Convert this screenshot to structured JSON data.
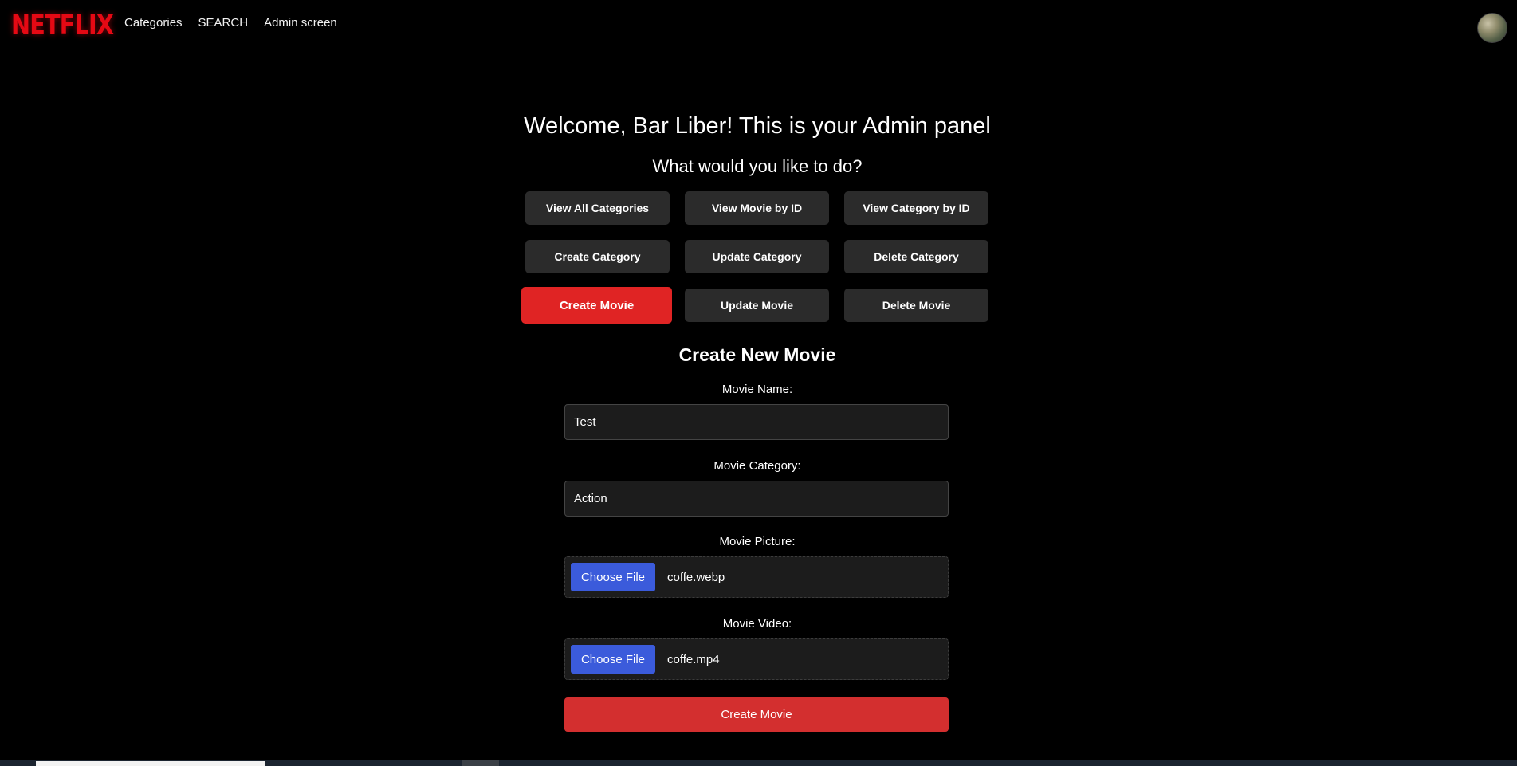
{
  "navbar": {
    "logo_text": "NETFLIX",
    "links": [
      "Categories",
      "SEARCH",
      "Admin screen"
    ],
    "avatar_icon": "user-avatar-icon"
  },
  "panel": {
    "welcome": "Welcome, Bar Liber! This is your Admin panel",
    "subtitle": "What would you like to do?",
    "actions": [
      "View All Categories",
      "View Movie by ID",
      "View Category by ID",
      "Create Category",
      "Update Category",
      "Delete Category",
      "Create Movie",
      "Update Movie",
      "Delete Movie"
    ],
    "active_action": "Create Movie"
  },
  "form": {
    "title": "Create New Movie",
    "name_label": "Movie Name:",
    "name_value": "Test",
    "category_label": "Movie Category:",
    "category_value": "Action",
    "picture_label": "Movie Picture:",
    "picture_button": "Choose File",
    "picture_file": "coffe.webp",
    "video_label": "Movie Video:",
    "video_button": "Choose File",
    "video_file": "coffe.mp4",
    "submit_label": "Create Movie"
  },
  "colors": {
    "brand": "#e50914",
    "active_button": "#e02424",
    "submit": "#d32f2f",
    "choose_file": "#3b5bdb",
    "button_bg": "#2b2b2b"
  }
}
